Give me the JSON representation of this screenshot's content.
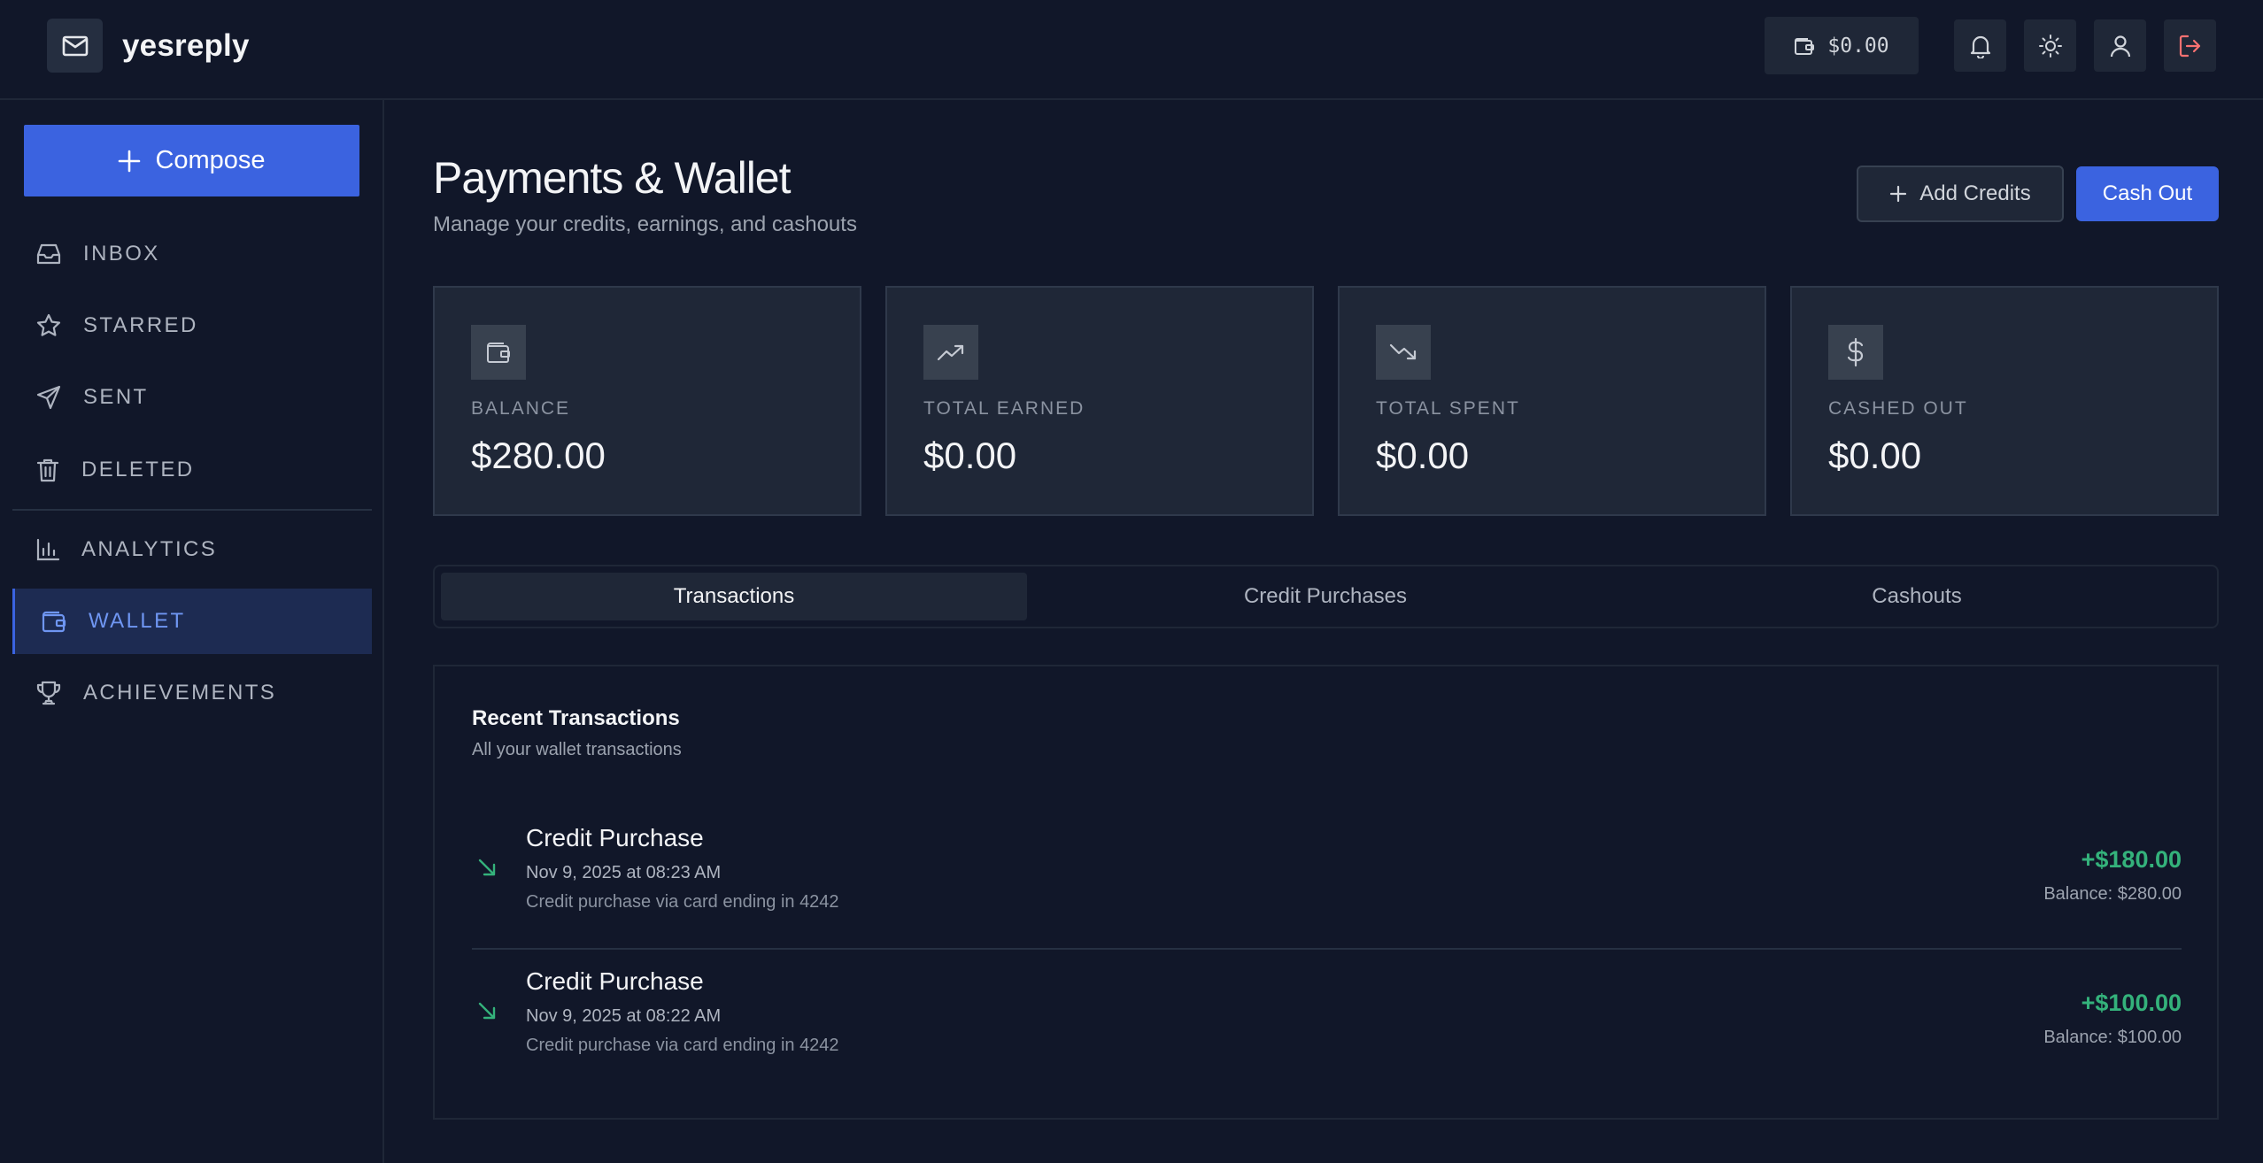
{
  "app": {
    "name": "yesreply",
    "wallet_chip": "$0.00"
  },
  "sidebar": {
    "compose_label": "Compose",
    "items": [
      {
        "label": "INBOX",
        "icon": "inbox-icon"
      },
      {
        "label": "STARRED",
        "icon": "star-icon"
      },
      {
        "label": "SENT",
        "icon": "send-icon"
      },
      {
        "label": "DELETED",
        "icon": "trash-icon"
      },
      {
        "label": "ANALYTICS",
        "icon": "bar-chart-icon"
      },
      {
        "label": "WALLET",
        "icon": "wallet-icon",
        "active": true
      },
      {
        "label": "ACHIEVEMENTS",
        "icon": "trophy-icon"
      }
    ]
  },
  "page": {
    "title": "Payments & Wallet",
    "subtitle": "Manage your credits, earnings, and cashouts",
    "add_credits_label": "Add Credits",
    "cash_out_label": "Cash Out"
  },
  "stats": [
    {
      "label": "BALANCE",
      "value": "$280.00",
      "icon": "wallet-icon"
    },
    {
      "label": "TOTAL EARNED",
      "value": "$0.00",
      "icon": "trending-up-icon"
    },
    {
      "label": "TOTAL SPENT",
      "value": "$0.00",
      "icon": "trending-down-icon"
    },
    {
      "label": "CASHED OUT",
      "value": "$0.00",
      "icon": "dollar-icon"
    }
  ],
  "tabs": [
    {
      "label": "Transactions",
      "active": true
    },
    {
      "label": "Credit Purchases"
    },
    {
      "label": "Cashouts"
    }
  ],
  "transactions_panel": {
    "title": "Recent Transactions",
    "subtitle": "All your wallet transactions",
    "items": [
      {
        "title": "Credit Purchase",
        "date": "Nov 9, 2025 at 08:23 AM",
        "description": "Credit purchase via card ending in 4242",
        "amount": "+$180.00",
        "balance": "Balance: $280.00"
      },
      {
        "title": "Credit Purchase",
        "date": "Nov 9, 2025 at 08:22 AM",
        "description": "Credit purchase via card ending in 4242",
        "amount": "+$100.00",
        "balance": "Balance: $100.00"
      }
    ]
  },
  "colors": {
    "background": "#111729",
    "card": "#1f2737",
    "accent": "#3b63e0",
    "positive": "#34b27b",
    "logout": "#f87171"
  }
}
